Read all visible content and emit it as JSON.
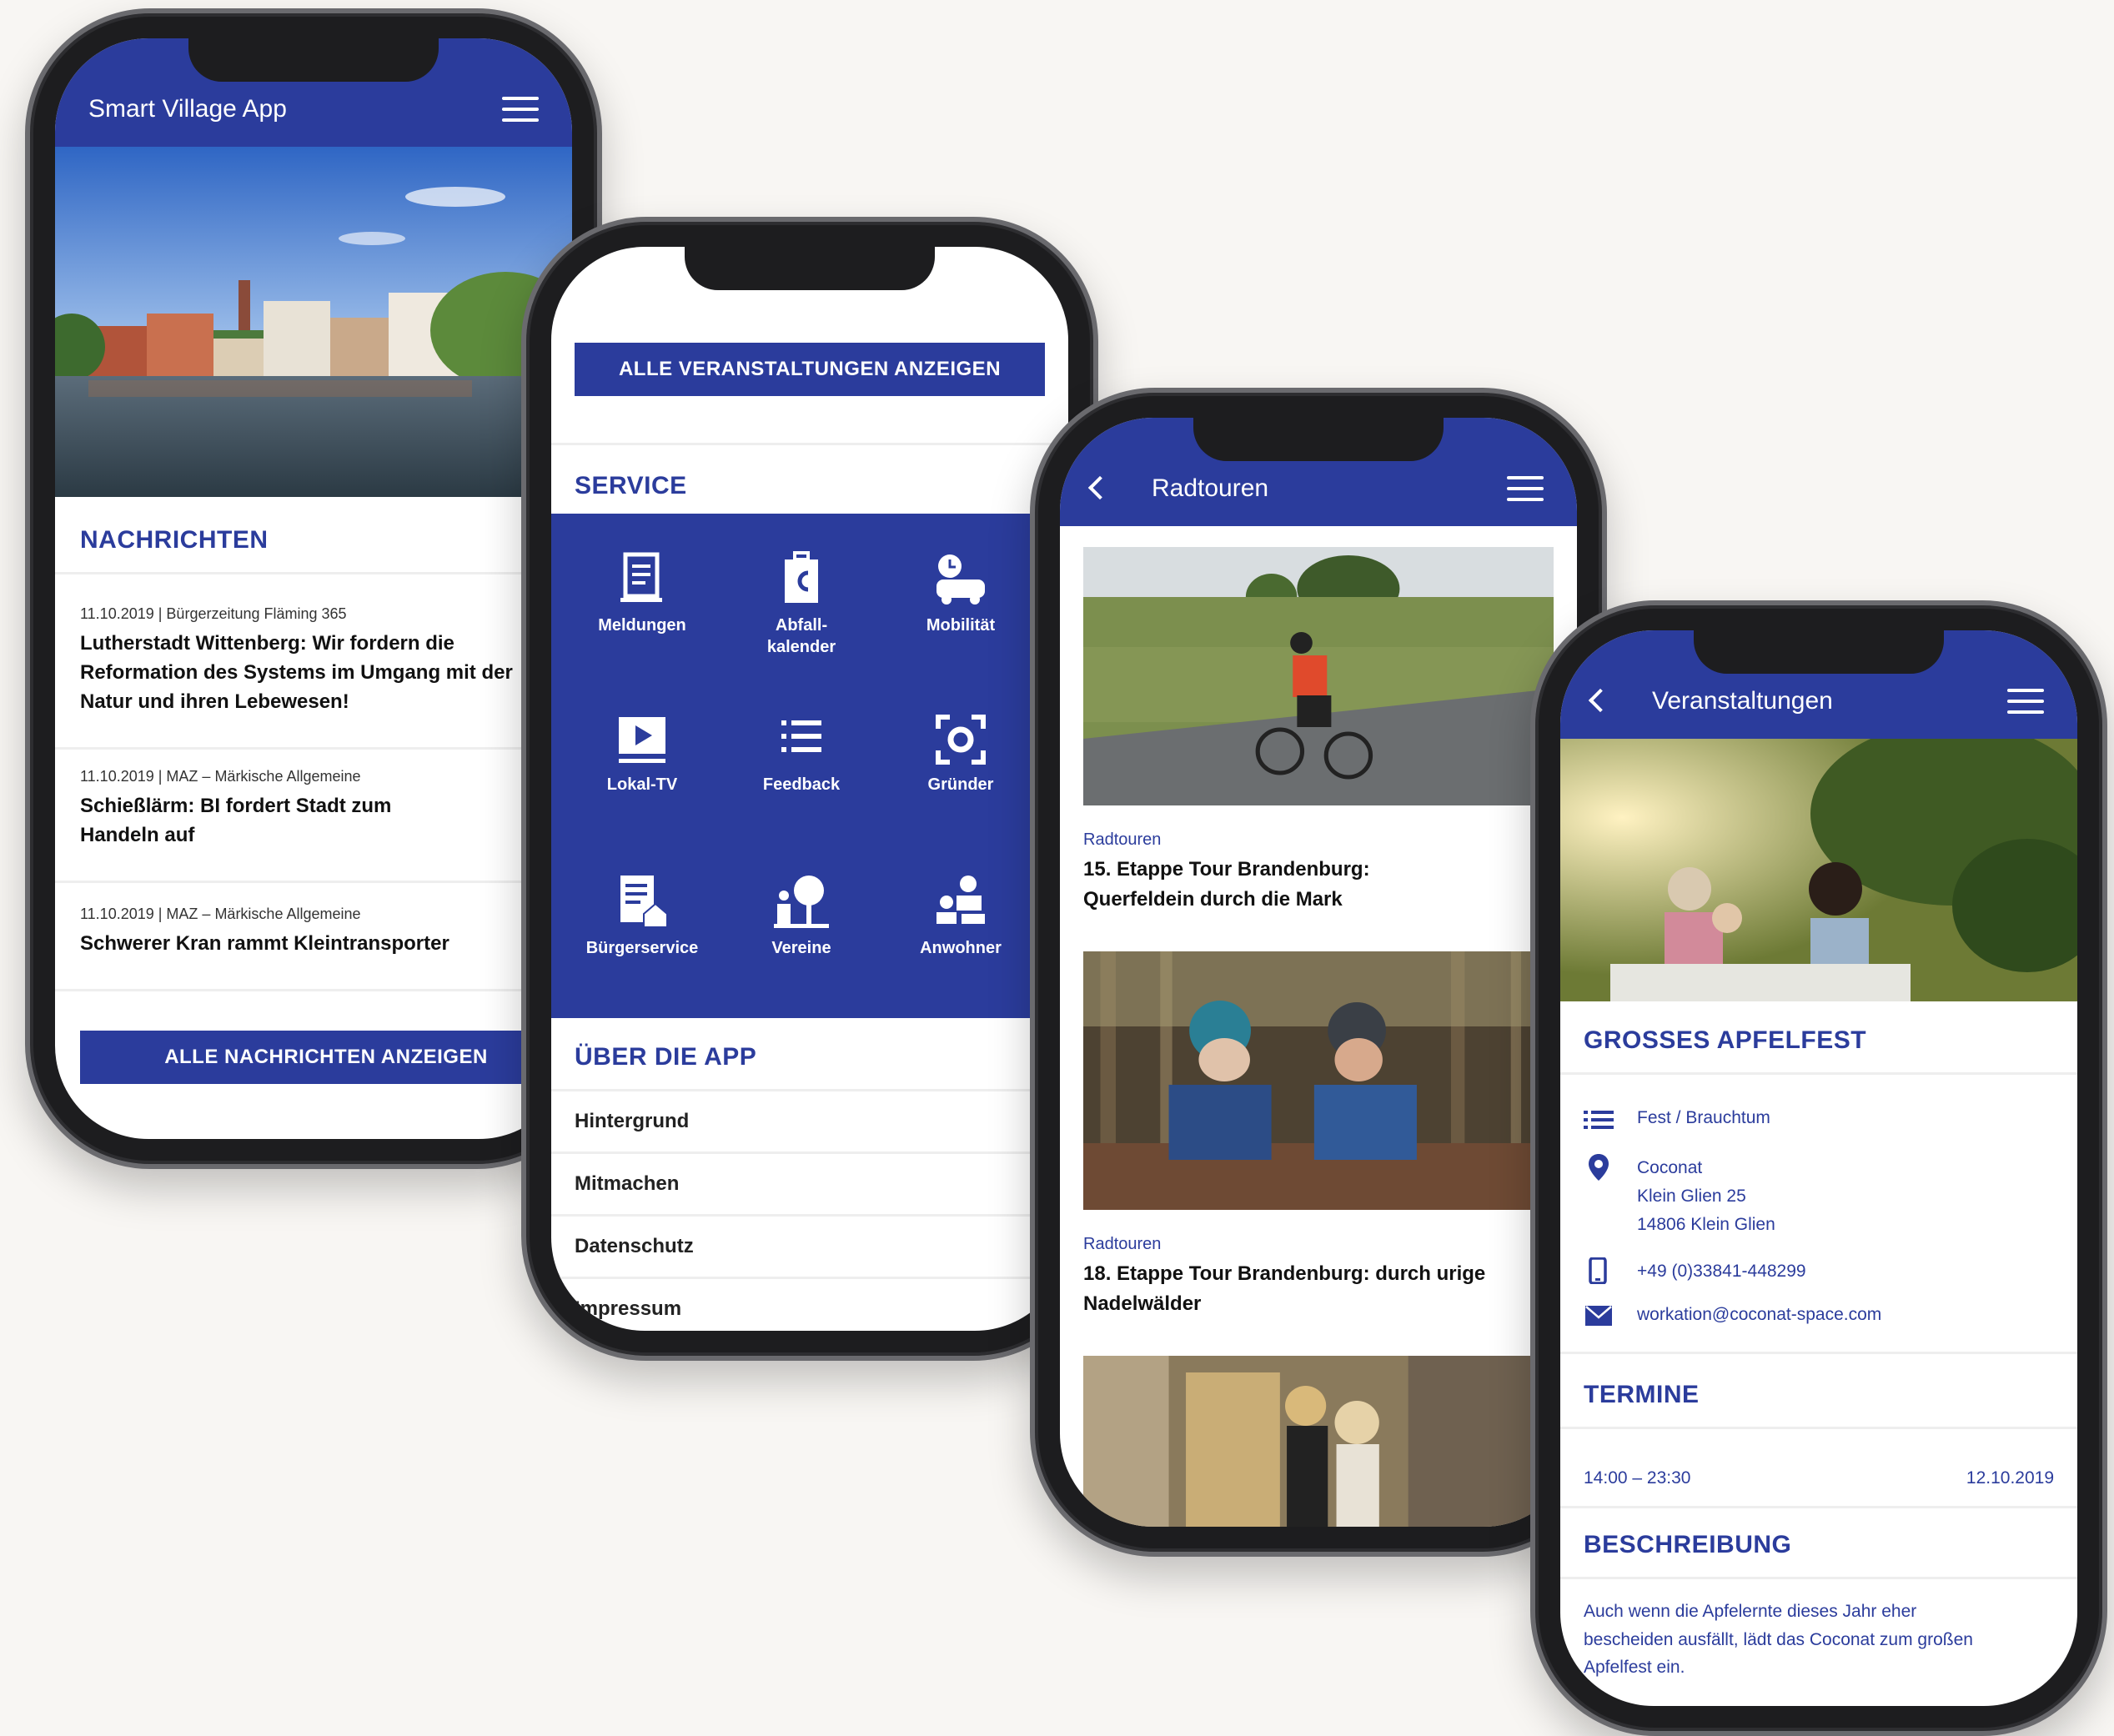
{
  "phone1": {
    "app_title": "Smart Village App",
    "section_news": "NACHRICHTEN",
    "news": [
      {
        "meta": "11.10.2019 | Bürgerzeitung Fläming 365",
        "headline": "Lutherstadt Wittenberg: Wir fordern die Reformation des Systems im Umgang mit der Natur und ihren Lebewesen!"
      },
      {
        "meta": "11.10.2019 | MAZ – Märkische Allgemeine",
        "headline": "Schießlärm: BI fordert Stadt zum Handeln auf"
      },
      {
        "meta": "11.10.2019 | MAZ – Märkische Allgemeine",
        "headline": "Schwerer Kran rammt Kleintransporter"
      }
    ],
    "all_news_button": "ALLE NACHRICHTEN ANZEIGEN"
  },
  "phone2": {
    "all_events_button": "ALLE VERANSTALTUNGEN ANZEIGEN",
    "section_service": "SERVICE",
    "services": [
      {
        "label": "Meldungen",
        "icon": "document-icon"
      },
      {
        "label": "Abfall-\nkalender",
        "icon": "trash-calendar-icon"
      },
      {
        "label": "Mobilität",
        "icon": "mobility-icon"
      },
      {
        "label": "Lokal-TV",
        "icon": "play-icon"
      },
      {
        "label": "Feedback",
        "icon": "list-icon"
      },
      {
        "label": "Gründer",
        "icon": "focus-icon"
      },
      {
        "label": "Bürgerservice",
        "icon": "form-house-icon"
      },
      {
        "label": "Vereine",
        "icon": "tree-person-icon"
      },
      {
        "label": "Anwohner",
        "icon": "people-icon"
      }
    ],
    "section_about": "ÜBER DIE APP",
    "about_items": [
      "Hintergrund",
      "Mitmachen",
      "Datenschutz",
      "Impressum"
    ]
  },
  "phone3": {
    "title": "Radtouren",
    "tours": [
      {
        "category": "Radtouren",
        "title": "15. Etappe Tour Brandenburg: Querfeldein durch die Mark"
      },
      {
        "category": "Radtouren",
        "title": "18. Etappe Tour Brandenburg: durch urige Nadelwälder"
      }
    ]
  },
  "phone4": {
    "title": "Veranstaltungen",
    "event_title": "GROSSES APFELFEST",
    "category": "Fest / Brauchtum",
    "location_lines": [
      "Coconat",
      "Klein Glien 25",
      "14806 Klein Glien"
    ],
    "phone": "+49 (0)33841-448299",
    "email": "workation@coconat-space.com",
    "section_dates": "TERMINE",
    "time": "14:00 – 23:30",
    "date": "12.10.2019",
    "section_description": "BESCHREIBUNG",
    "description": "Auch wenn die Apfelernte dieses Jahr eher bescheiden ausfällt, lädt das Coconat zum großen Apfelfest ein."
  },
  "colors": {
    "brand": "#2b3c9c",
    "background": "#f8f6f3"
  }
}
